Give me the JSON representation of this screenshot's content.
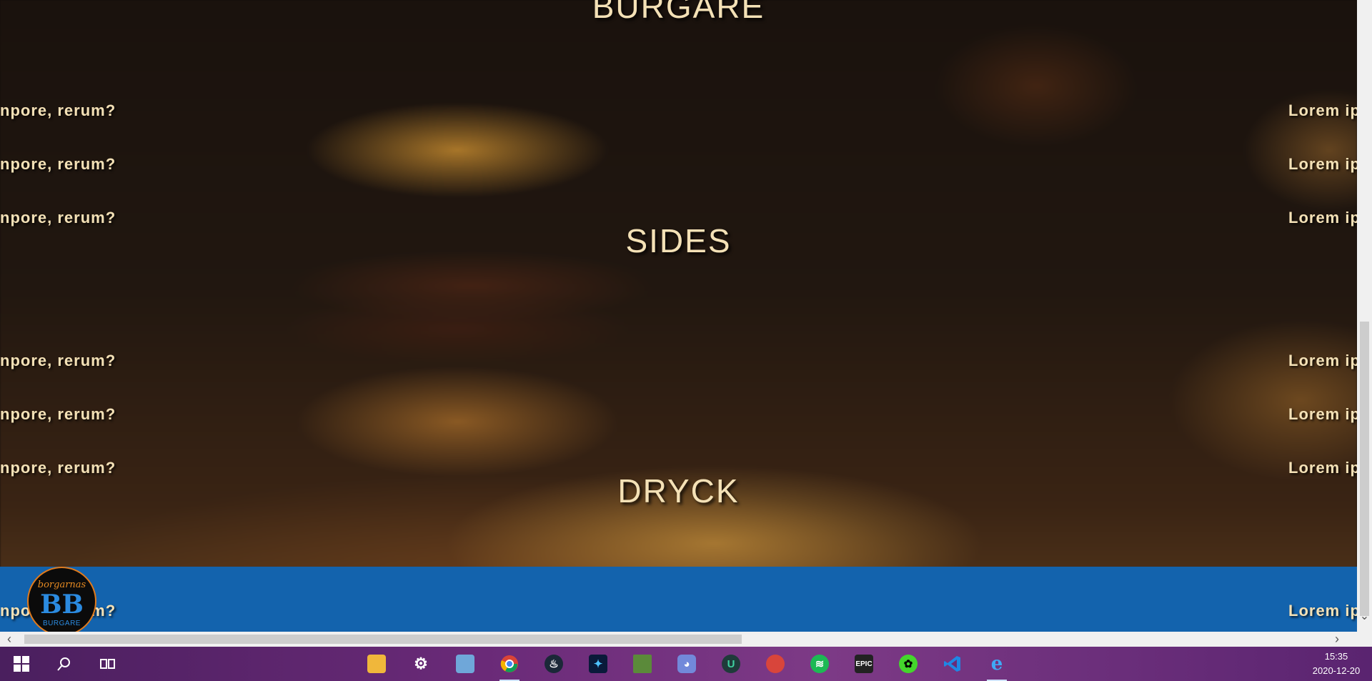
{
  "page": {
    "left_lines": [
      "npore, rerum?",
      "npore, rerum?",
      "npore, rerum?",
      "npore, rerum?",
      "npore, rerum?",
      "npore, rerum?",
      "npore, rerum?"
    ],
    "right_lines": [
      "Lorem ip",
      "Lorem ip",
      "Lorem ip",
      "Lorem ip",
      "Lorem ip",
      "Lorem ip",
      "Lorem ip"
    ],
    "section_partial": "BURGARE",
    "sections": {
      "sides": "SIDES",
      "dryck": "DRYCK"
    },
    "footer_line_left": "npore, rerum?",
    "footer_line_right": "Lorem ip"
  },
  "logo": {
    "script": "borgarnas",
    "initials": "BB",
    "word": "BURGARE"
  },
  "colors": {
    "text": "#f4e1b6",
    "footer": "#1363ad",
    "logo_orange": "#e07a1c",
    "logo_blue": "#2b8be0"
  },
  "scrollbars": {
    "horizontal_left": "‹",
    "horizontal_right": "›",
    "vertical_down": "⌄"
  },
  "taskbar": {
    "icons": [
      "windows-start-icon",
      "search-icon",
      "task-view-icon",
      "file-explorer-icon",
      "settings-icon",
      "control-panel-icon",
      "chrome-icon",
      "steam-icon",
      "battlenet-icon",
      "minecraft-icon",
      "discord-icon",
      "ubisoft-icon",
      "ccleaner-icon",
      "spotify-icon",
      "epic-games-icon",
      "razer-icon",
      "vscode-icon",
      "internet-explorer-icon"
    ],
    "epic_label": "EPIC",
    "time": "15:35",
    "date": "2020-12-20"
  }
}
